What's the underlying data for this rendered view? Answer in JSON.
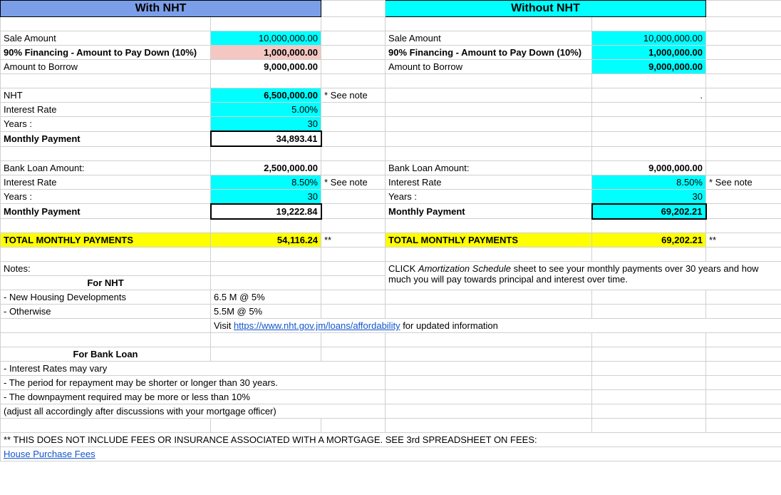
{
  "headers": {
    "with": "With NHT",
    "without": "Without NHT"
  },
  "labels": {
    "sale_amount": "Sale Amount",
    "financing": "90% Financing - Amount to Pay Down (10%)",
    "amount_borrow": "Amount to Borrow",
    "nht": "NHT",
    "interest_rate": "Interest Rate",
    "years": "Years :",
    "monthly_payment": "Monthly Payment",
    "bank_loan": "Bank Loan Amount:",
    "total_monthly": "TOTAL MONTHLY PAYMENTS",
    "see_note": "* See note",
    "dbl_star": "**",
    "notes": "Notes:",
    "for_nht": "For NHT",
    "new_housing": "- New Housing Developments",
    "otherwise": "- Otherwise",
    "for_bank": "For Bank Loan",
    "rates_vary": "- Interest Rates may vary",
    "period_repay": "- The period for repayment may be shorter or longer than 30 years.",
    "downpayment": "- The downpayment required may be more or less than 10%",
    "adjust": "(adjust all accordingly after discussions with your mortgage officer)",
    "disclaimer": "** THIS DOES NOT INCLUDE FEES OR INSURANCE ASSOCIATED WITH A MORTGAGE. SEE 3rd SPREADSHEET ON FEES:",
    "house_fees": "House Purchase Fees",
    "visit_prefix": "Visit ",
    "visit_suffix": " for updated information",
    "amort_prefix": "CLICK ",
    "amort_italic": "Amortization Schedule",
    "amort_suffix": " sheet to see your monthly payments over 30 years and how much you will pay towards principal and interest over time."
  },
  "with": {
    "sale_amount": "10,000,000.00",
    "financing": "1,000,000.00",
    "amount_borrow": "9,000,000.00",
    "nht_amount": "6,500,000.00",
    "nht_rate": "5.00%",
    "nht_years": "30",
    "nht_monthly": "34,893.41",
    "bank_amount": "2,500,000.00",
    "bank_rate": "8.50%",
    "bank_years": "30",
    "bank_monthly": "19,222.84",
    "total": "54,116.24"
  },
  "without": {
    "sale_amount": "10,000,000.00",
    "financing": "1,000,000.00",
    "amount_borrow": "9,000,000.00",
    "bank_amount": "9,000,000.00",
    "bank_rate": "8.50%",
    "bank_years": "30",
    "bank_monthly": "69,202.21",
    "total": "69,202.21"
  },
  "notes": {
    "new_housing_val": "6.5 M @ 5%",
    "otherwise_val": "5.5M @ 5%",
    "nht_url": "https://www.nht.gov.jm/loans/affordability"
  }
}
